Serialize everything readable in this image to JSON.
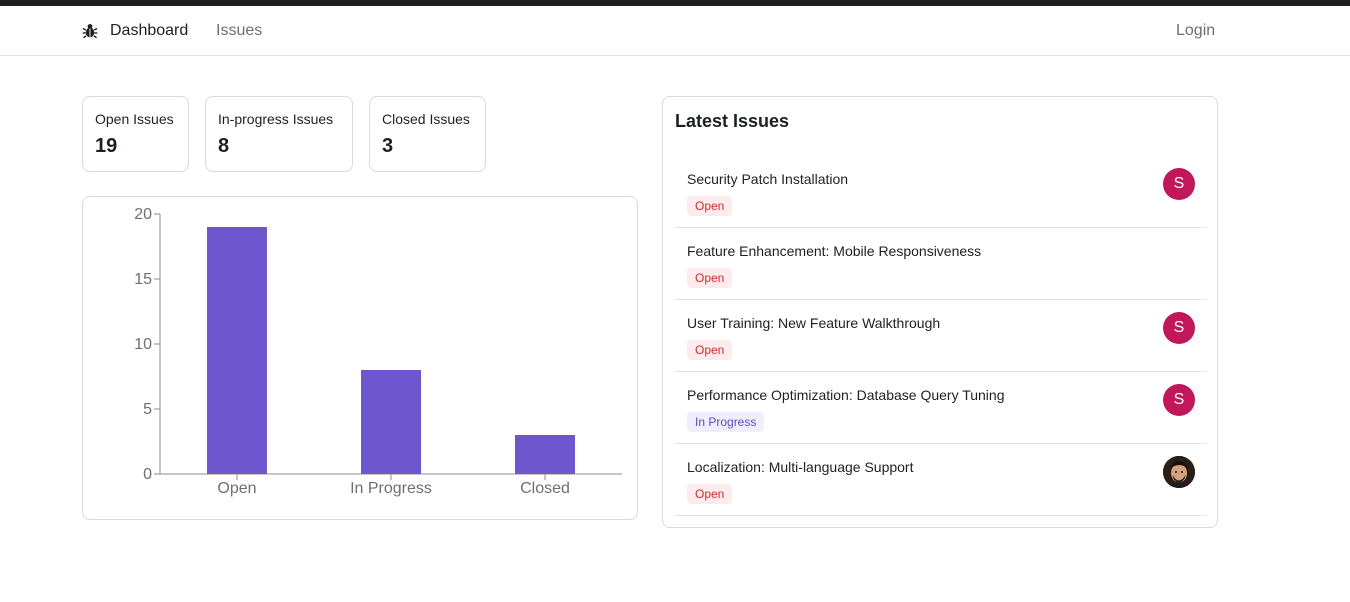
{
  "nav": {
    "logo_icon": "bug-icon",
    "dashboard": "Dashboard",
    "issues": "Issues",
    "login": "Login"
  },
  "stats": [
    {
      "label": "Open Issues",
      "value": "19"
    },
    {
      "label": "In-progress Issues",
      "value": "8"
    },
    {
      "label": "Closed Issues",
      "value": "3"
    }
  ],
  "chart_data": {
    "type": "bar",
    "categories": [
      "Open",
      "In Progress",
      "Closed"
    ],
    "values": [
      19,
      8,
      3
    ],
    "yticks": [
      0,
      5,
      10,
      15,
      20
    ],
    "ylim": [
      0,
      20
    ],
    "bar_color": "#6e56cf",
    "grid": false
  },
  "latest": {
    "title": "Latest Issues",
    "issues": [
      {
        "title": "Security Patch Installation",
        "status": "Open",
        "avatar": "S"
      },
      {
        "title": "Feature Enhancement: Mobile Responsiveness",
        "status": "Open",
        "avatar": ""
      },
      {
        "title": "User Training: New Feature Walkthrough",
        "status": "Open",
        "avatar": "S"
      },
      {
        "title": "Performance Optimization: Database Query Tuning",
        "status": "In Progress",
        "avatar": "S"
      },
      {
        "title": "Localization: Multi-language Support",
        "status": "Open",
        "avatar": "photo"
      }
    ]
  },
  "colors": {
    "accent": "#6e56cf",
    "avatar": "#c2185b",
    "open_badge_bg": "#feebec",
    "open_badge_text": "#ce2c31",
    "progress_badge_bg": "#f0eefe",
    "progress_badge_text": "#5b4bbd"
  }
}
